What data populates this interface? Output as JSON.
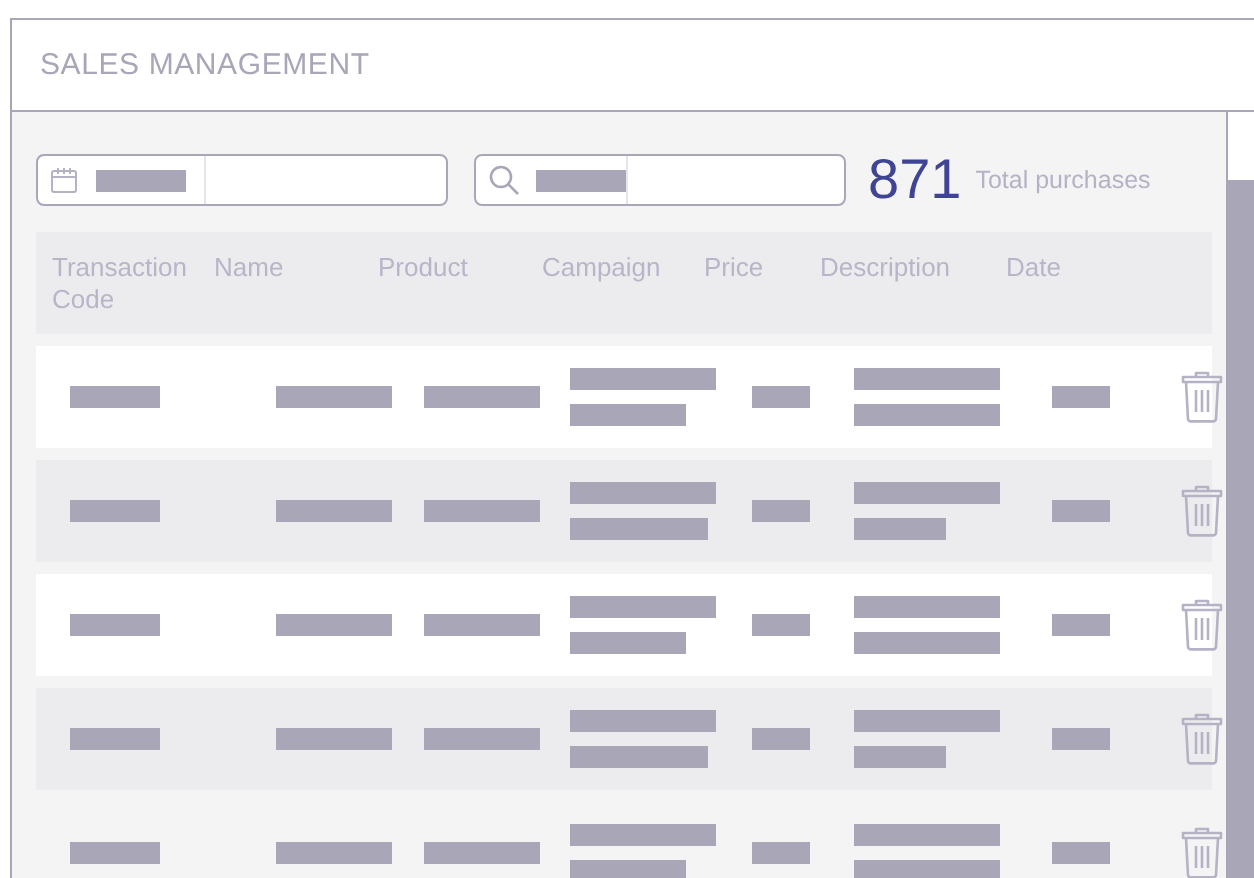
{
  "window": {
    "title": "SALES MANAGEMENT"
  },
  "filters": {
    "date_field": {
      "kind": "date"
    },
    "search_field": {
      "kind": "search"
    }
  },
  "summary": {
    "count": "871",
    "label": "Total purchases"
  },
  "table": {
    "columns": [
      "Transaction Code",
      "Name",
      "Product",
      "Campaign",
      "Price",
      "Description",
      "Date"
    ],
    "rows": [
      {
        "kind": "light"
      },
      {
        "kind": "shaded"
      },
      {
        "kind": "light"
      },
      {
        "kind": "shaded"
      },
      {
        "kind": "plain"
      }
    ]
  }
}
